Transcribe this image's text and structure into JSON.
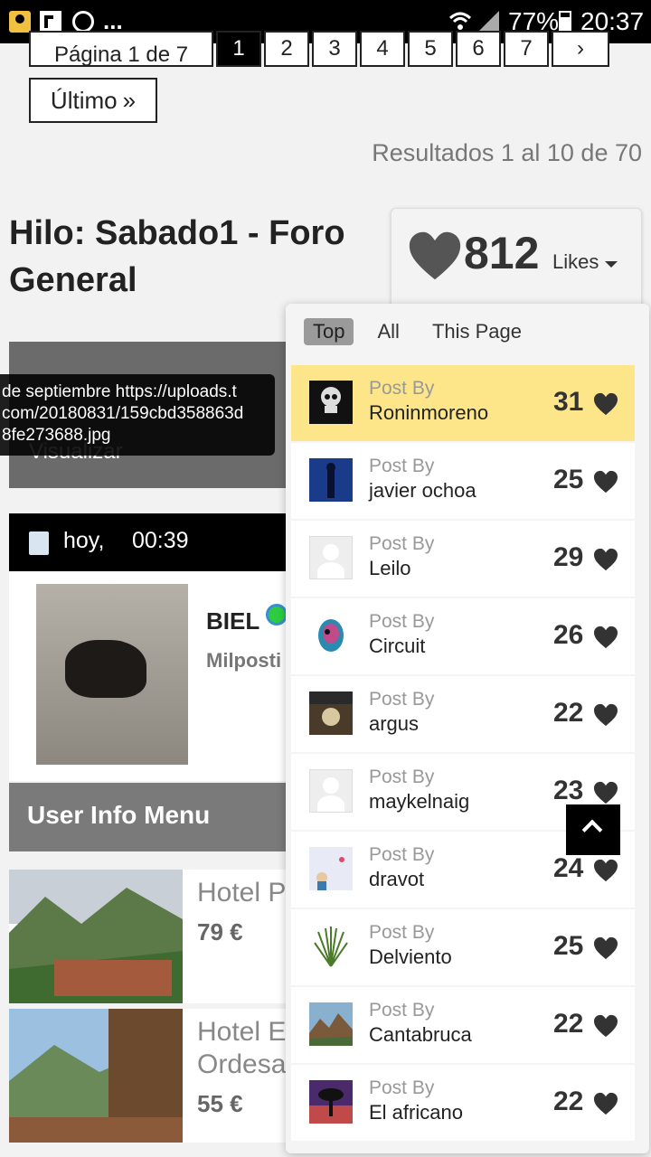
{
  "status_bar": {
    "dots": "...",
    "battery": "77%",
    "battery_level": 0.77,
    "time": "20:37"
  },
  "pagination": {
    "info": "Página 1 de 7",
    "pages": [
      "1",
      "2",
      "3",
      "4",
      "5",
      "6",
      "7"
    ],
    "current": "1",
    "next": "›",
    "last_label": "Último",
    "last_icon": "»"
  },
  "results_text": "Resultados 1 al 10 de 70",
  "thread_title": "Hilo: Sabado1 - Foro General",
  "likes": {
    "count": "812",
    "label": "Likes"
  },
  "tooltip": {
    "line1": "de septiembre https://uploads.t",
    "line2": "com/20180831/159cbd358863d",
    "line3": "8fe273688.jpg"
  },
  "visualizar": "Visualizar",
  "post": {
    "date": "hoy,",
    "time": "00:39",
    "author": "BIEL",
    "rank": "Milposti"
  },
  "user_info_menu": "User Info Menu",
  "hotels": [
    {
      "name": "Hotel P",
      "price": "79 €"
    },
    {
      "name": "Hotel E\nOrdesa",
      "price": "55 €"
    }
  ],
  "dropdown": {
    "tabs": [
      "Top",
      "All",
      "This Page"
    ],
    "active_tab": "Top",
    "post_by_label": "Post By",
    "rows": [
      {
        "user": "Roninmoreno",
        "count": "31",
        "avatar": "skull-avatar"
      },
      {
        "user": "javier ochoa",
        "count": "25",
        "avatar": "photo-avatar"
      },
      {
        "user": "Leilo",
        "count": "29",
        "avatar": "default-avatar"
      },
      {
        "user": "Circuit",
        "count": "26",
        "avatar": "art-avatar"
      },
      {
        "user": "argus",
        "count": "22",
        "avatar": "photo-avatar"
      },
      {
        "user": "maykelnaig",
        "count": "23",
        "avatar": "default-avatar"
      },
      {
        "user": "dravot",
        "count": "24",
        "avatar": "cartoon-avatar"
      },
      {
        "user": "Delviento",
        "count": "25",
        "avatar": "plant-avatar"
      },
      {
        "user": "Cantabruca",
        "count": "22",
        "avatar": "mountain-avatar"
      },
      {
        "user": "El africano",
        "count": "22",
        "avatar": "sunset-avatar"
      }
    ]
  },
  "colors": {
    "highlight_row": "#fde68a",
    "header_black": "#000000",
    "heart": "#333333"
  }
}
